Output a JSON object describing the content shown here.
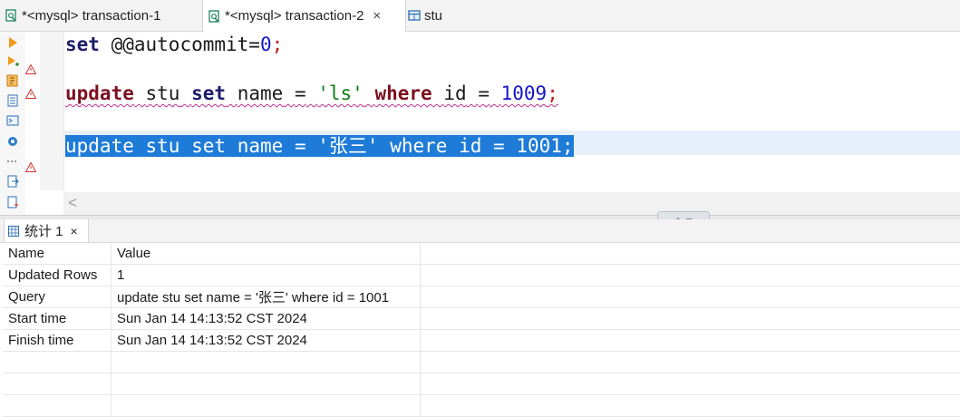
{
  "tabs": [
    {
      "label": "*<mysql> transaction-1",
      "active": false,
      "icon": "sql-file-icon"
    },
    {
      "label": "*<mysql> transaction-2",
      "active": true,
      "icon": "sql-file-icon",
      "close": "×"
    },
    {
      "label": "stu",
      "active": false,
      "icon": "table-icon"
    }
  ],
  "editor": {
    "lines": [
      {
        "tokens": [
          "set",
          "@@autocommit=",
          "0",
          ";"
        ]
      },
      {
        "tokens": [
          "update",
          "stu",
          "set",
          "name",
          "=",
          "'ls'",
          "where",
          "id",
          "=",
          "1009",
          ";"
        ]
      },
      {
        "tokens": [
          "update",
          "stu",
          "set",
          "name",
          "=",
          "'张三'",
          "where",
          "id",
          "=",
          "1001",
          ";"
        ]
      }
    ],
    "scroll_left_arrow": "<"
  },
  "results": {
    "tab_label": "统计 1",
    "tab_close": "×",
    "columns": [
      "Name",
      "Value"
    ],
    "rows": [
      [
        "Updated Rows",
        "1"
      ],
      [
        "Query",
        "update stu set name = '张三' where id = 1001"
      ],
      [
        "Start time",
        "Sun Jan 14 14:13:52 CST 2024"
      ],
      [
        "Finish time",
        "Sun Jan 14 14:13:52 CST 2024"
      ],
      [
        "",
        ""
      ],
      [
        "",
        ""
      ],
      [
        "",
        ""
      ]
    ]
  },
  "colors": {
    "selection": "#1e7bd8",
    "keyword": "#1d1d6b",
    "string": "#117a11",
    "number": "#1515c8",
    "warning": "#d23030"
  }
}
